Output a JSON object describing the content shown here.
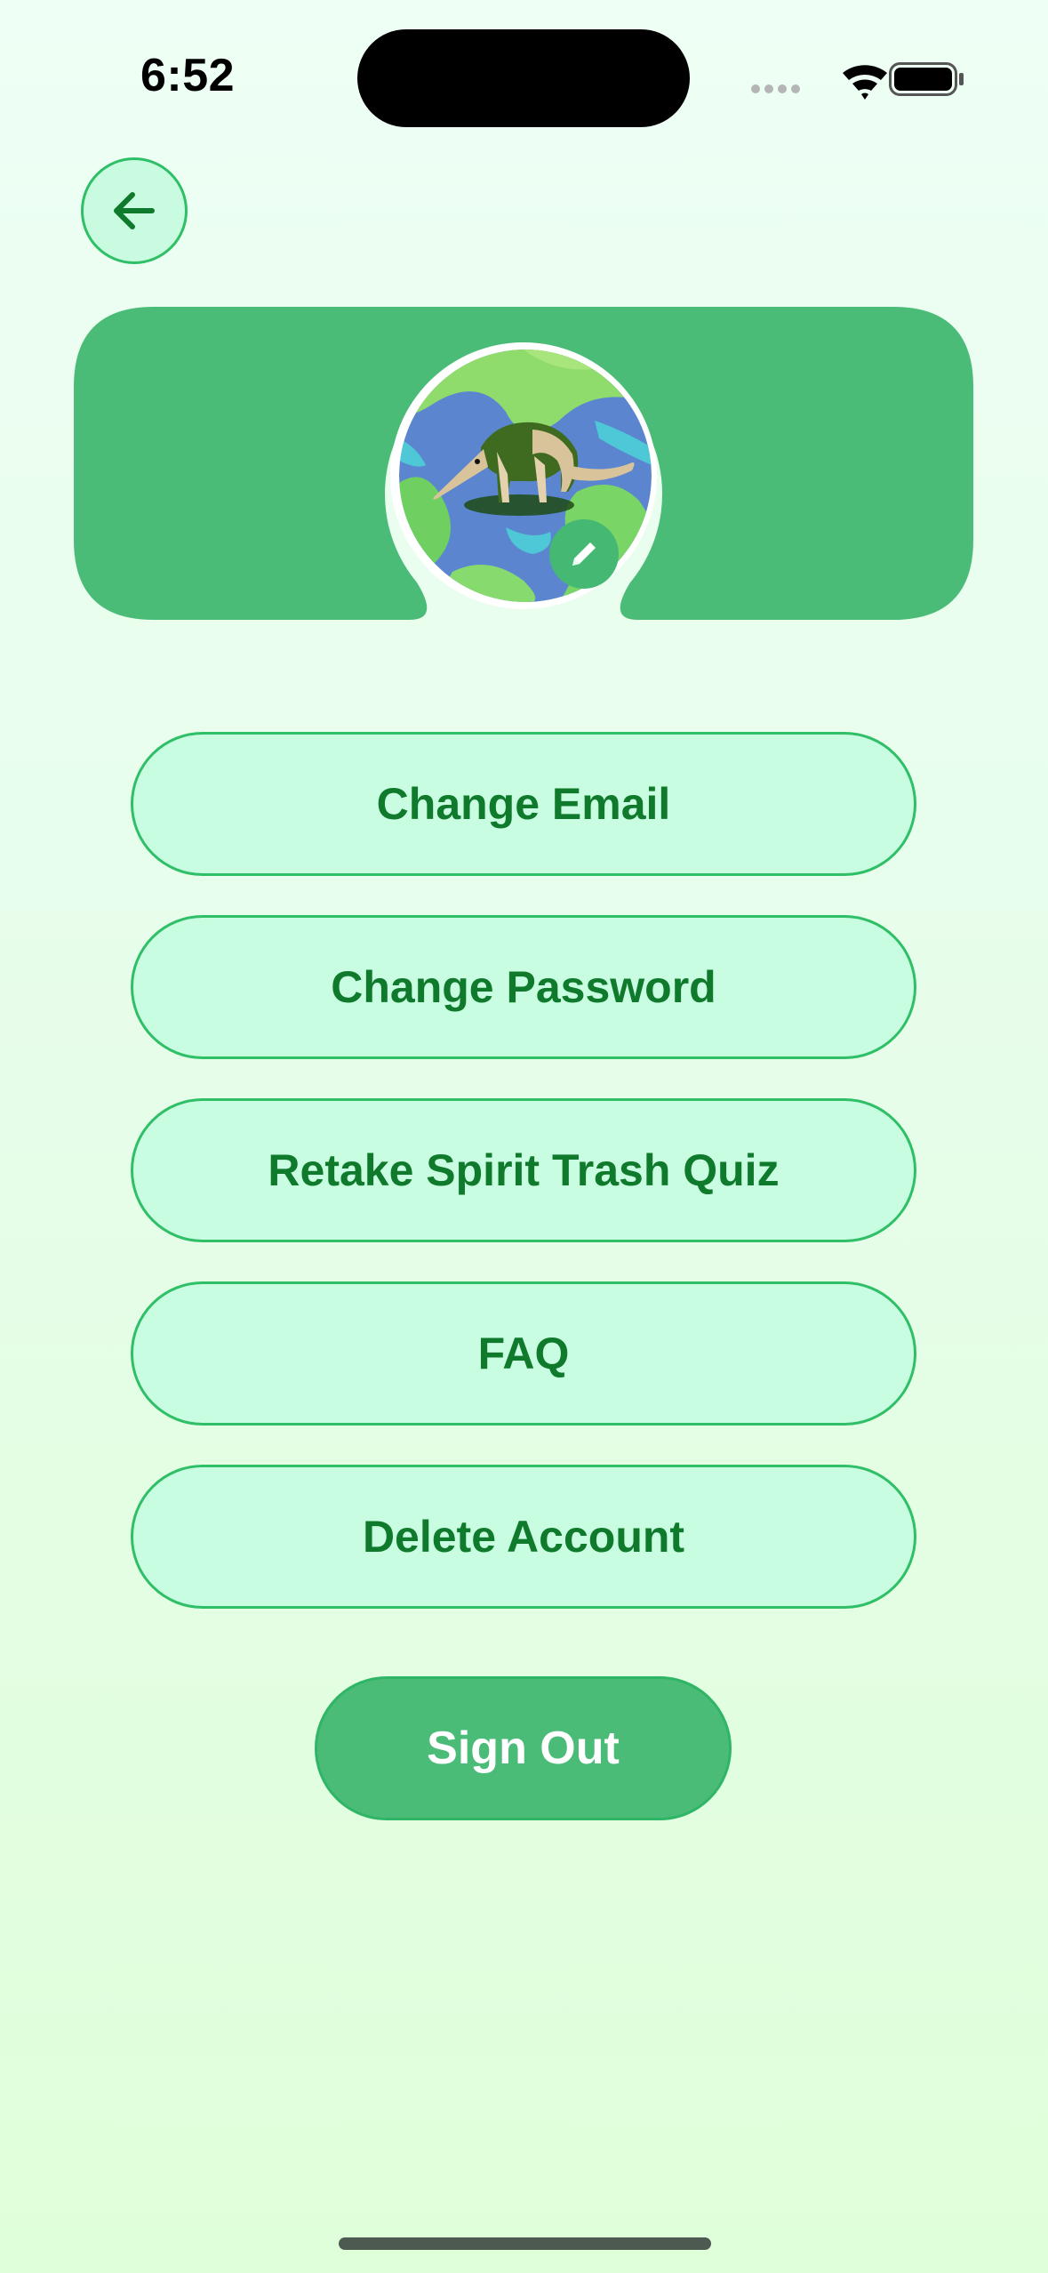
{
  "status_bar": {
    "time": "6:52",
    "icons": [
      "cellular-signal-icon",
      "wifi-icon",
      "battery-icon"
    ]
  },
  "header": {
    "back_icon": "arrow-left-icon"
  },
  "profile": {
    "avatar_description_icon": "anteater-globe-avatar",
    "edit_icon": "pencil-icon"
  },
  "menu": {
    "items": [
      {
        "label": "Change Email"
      },
      {
        "label": "Change Password"
      },
      {
        "label": "Retake Spirit Trash Quiz"
      },
      {
        "label": "FAQ"
      },
      {
        "label": "Delete Account"
      }
    ],
    "sign_out_label": "Sign Out"
  },
  "colors": {
    "accent": "#4bbc78",
    "button_fill": "#c9fde1",
    "button_border": "#2fbf67",
    "button_text": "#0f7a2c"
  }
}
